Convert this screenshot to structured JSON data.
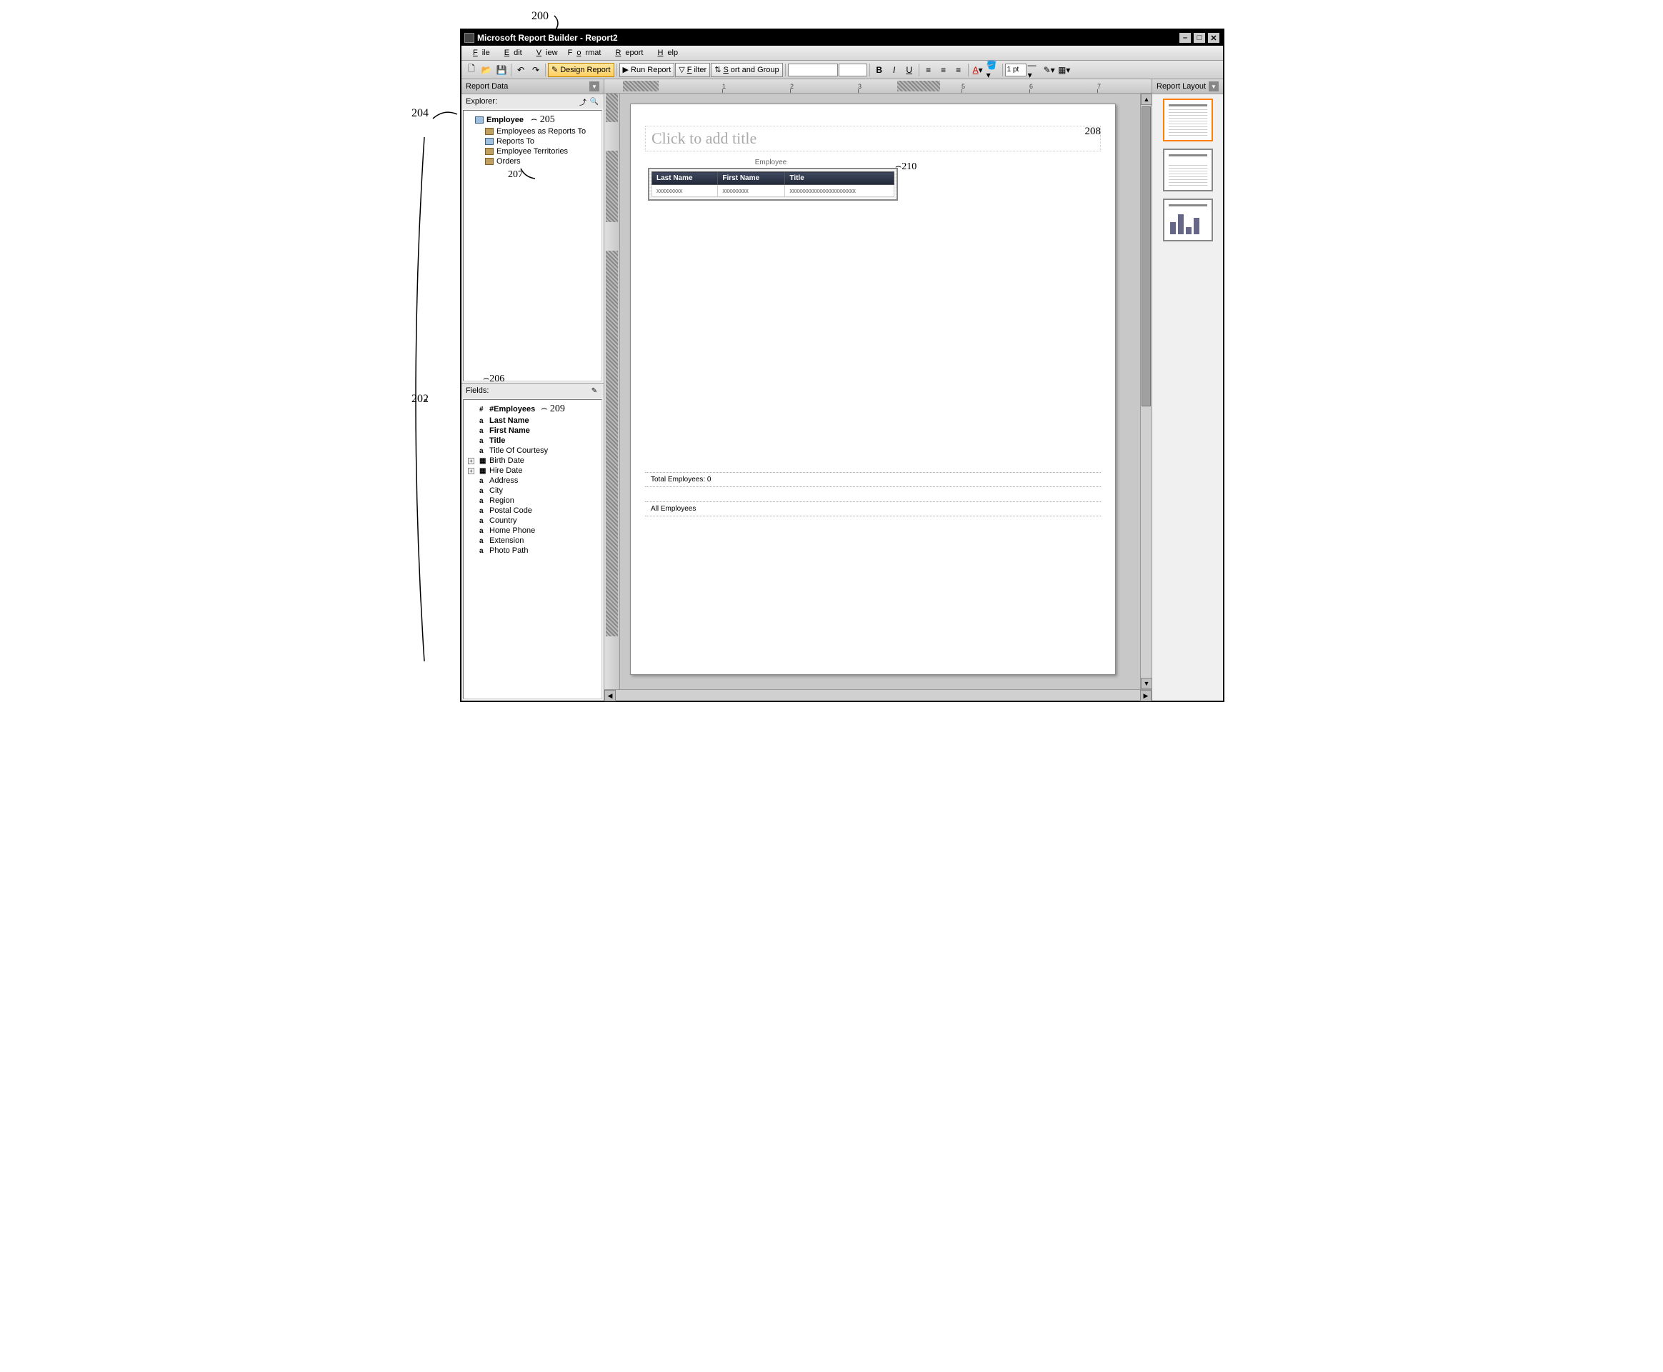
{
  "annotations": {
    "n200": "200",
    "n204": "204",
    "n202": "202",
    "n205": "205",
    "n207": "207",
    "n206": "206",
    "n209": "209",
    "n208": "208",
    "n210": "210"
  },
  "titlebar": {
    "text": "Microsoft Report Builder - Report2"
  },
  "menu": {
    "file": "File",
    "edit": "Edit",
    "view": "View",
    "format": "Format",
    "report": "Report",
    "help": "Help"
  },
  "toolbar": {
    "design": "Design Report",
    "run": "Run Report",
    "filter": "Filter",
    "sort": "Sort and Group",
    "bold": "B",
    "italic": "I",
    "underline": "U",
    "pt_value": "1 pt"
  },
  "left": {
    "report_data": "Report Data",
    "explorer_label": "Explorer:",
    "tree": {
      "employee": "Employee",
      "reports_to_role": "Employees as Reports To",
      "reports_to": "Reports To",
      "territories": "Employee Territories",
      "orders": "Orders"
    },
    "fields_label": "Fields:",
    "fields": {
      "count": "#Employees",
      "lastname": "Last Name",
      "firstname": "First Name",
      "title": "Title",
      "courtesy": "Title Of Courtesy",
      "birthdate": "Birth Date",
      "hiredate": "Hire Date",
      "address": "Address",
      "city": "City",
      "region": "Region",
      "postal": "Postal Code",
      "country": "Country",
      "homephone": "Home Phone",
      "extension": "Extension",
      "photopath": "Photo Path"
    }
  },
  "ruler": {
    "n1": "1",
    "n2": "2",
    "n3": "3",
    "n5": "5",
    "n6": "6",
    "n7": "7"
  },
  "canvas": {
    "title_placeholder": "Click to add title",
    "entity_label": "Employee",
    "col_lastname": "Last Name",
    "col_firstname": "First Name",
    "col_title": "Title",
    "cell_lastname": "xxxxxxxxx",
    "cell_firstname": "xxxxxxxxx",
    "cell_title": "xxxxxxxxxxxxxxxxxxxxxxx",
    "total_label": "Total Employees: 0",
    "filter_label": "All Employees"
  },
  "right": {
    "header": "Report Layout"
  }
}
